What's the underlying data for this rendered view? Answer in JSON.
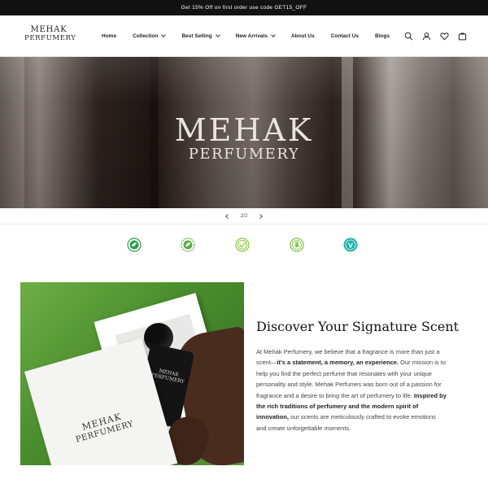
{
  "announcement": {
    "text": "Get 15% Off on first order use code GET15_OFF"
  },
  "logo": {
    "line1": "MEHAK",
    "line2": "PERFUMERY"
  },
  "nav": {
    "items": [
      {
        "label": "Home",
        "has_dropdown": false
      },
      {
        "label": "Collection",
        "has_dropdown": true
      },
      {
        "label": "Best Selling",
        "has_dropdown": true
      },
      {
        "label": "New Arrivals",
        "has_dropdown": true
      },
      {
        "label": "About Us",
        "has_dropdown": false
      },
      {
        "label": "Contact Us",
        "has_dropdown": false
      },
      {
        "label": "Blogs",
        "has_dropdown": false
      }
    ]
  },
  "header_icons": [
    "search-icon",
    "account-icon",
    "wishlist-icon",
    "cart-icon"
  ],
  "hero": {
    "line1": "MEHAK",
    "line2": "PERFUMERY"
  },
  "slider": {
    "counter": "2/2"
  },
  "badges": [
    {
      "name": "eco-badge",
      "color": "#2e9d4f"
    },
    {
      "name": "leaf-badge",
      "color": "#5bb04a"
    },
    {
      "name": "natural-badge",
      "color": "#8cc63f"
    },
    {
      "name": "cruelty-free-badge",
      "color": "#7dc242"
    },
    {
      "name": "vegan-badge",
      "color": "#20b3a8"
    }
  ],
  "product_image": {
    "box_line1": "MEHAK",
    "box_line2": "PERFUMERY",
    "bottle_line1": "MEHAK",
    "bottle_line2": "PERFUMERY"
  },
  "about": {
    "heading": "Discover Your Signature Scent",
    "p1": "At Mehak Perfumery, we believe that a fragrance is more than just a scent—",
    "p2": "it's a statement, a memory, an experience.",
    "p3": " Our mission is to help you find the perfect perfume that resonates with your unique personality and style. Mehak Perfumes was born out of a passion for fragrance and a desire to bring the art of perfumery to life. ",
    "p4": "Inspired by the rich traditions of perfumery and the modern spirit of innovation,",
    "p5": " our scents are meticulously crafted to evoke emotions and create unforgettable moments."
  },
  "colors": {
    "announcement_bg": "#121212",
    "text": "#121212",
    "body_text": "#444444"
  }
}
